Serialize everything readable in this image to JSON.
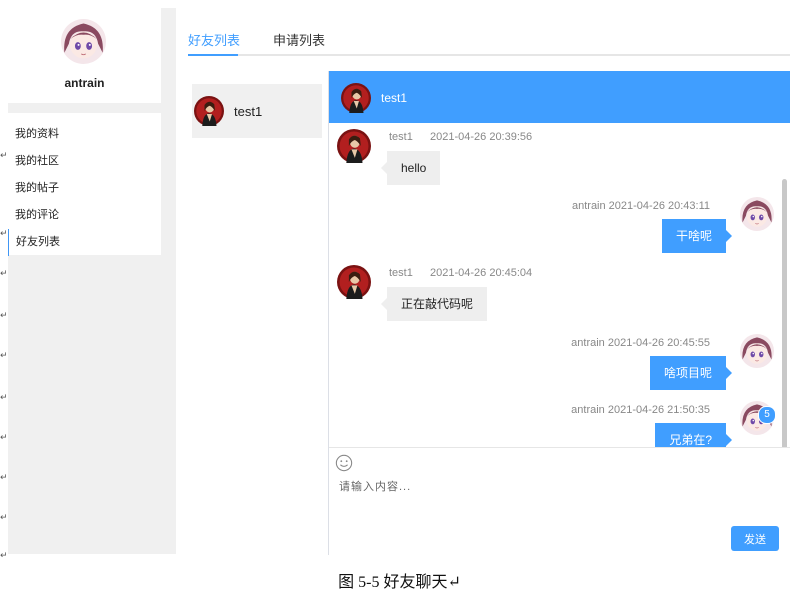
{
  "sidebar": {
    "username": "antrain",
    "menu": [
      {
        "label": "我的资料"
      },
      {
        "label": "我的社区"
      },
      {
        "label": "我的帖子"
      },
      {
        "label": "我的评论"
      },
      {
        "label": "好友列表",
        "active": true
      }
    ]
  },
  "tabs": [
    {
      "label": "好友列表",
      "active": true
    },
    {
      "label": "申请列表"
    }
  ],
  "friends": [
    {
      "name": "test1"
    }
  ],
  "chat": {
    "header_name": "test1",
    "messages": [
      {
        "side": "left",
        "user": "test1",
        "time": "2021-04-26 20:39:56",
        "text": "hello"
      },
      {
        "side": "right",
        "meta": "antrain 2021-04-26 20:43:11",
        "text": "干啥呢"
      },
      {
        "side": "left",
        "user": "test1",
        "time": "2021-04-26 20:45:04",
        "text": "正在敲代码呢"
      },
      {
        "side": "right",
        "meta": "antrain 2021-04-26 20:45:55",
        "text": "啥项目呢"
      },
      {
        "side": "right",
        "meta": "antrain 2021-04-26 21:50:35",
        "text": "兄弟在?"
      }
    ],
    "badge": "5",
    "input_placeholder": "请输入内容...",
    "send_label": "发送"
  },
  "icons": {
    "emoji": "smiley-icon",
    "return_mark": "↵"
  },
  "caption": "图 5-5 好友聊天↵",
  "colors": {
    "accent": "#409eff",
    "panel": "#f0f0f0",
    "bubble_left": "#eeeeee"
  }
}
